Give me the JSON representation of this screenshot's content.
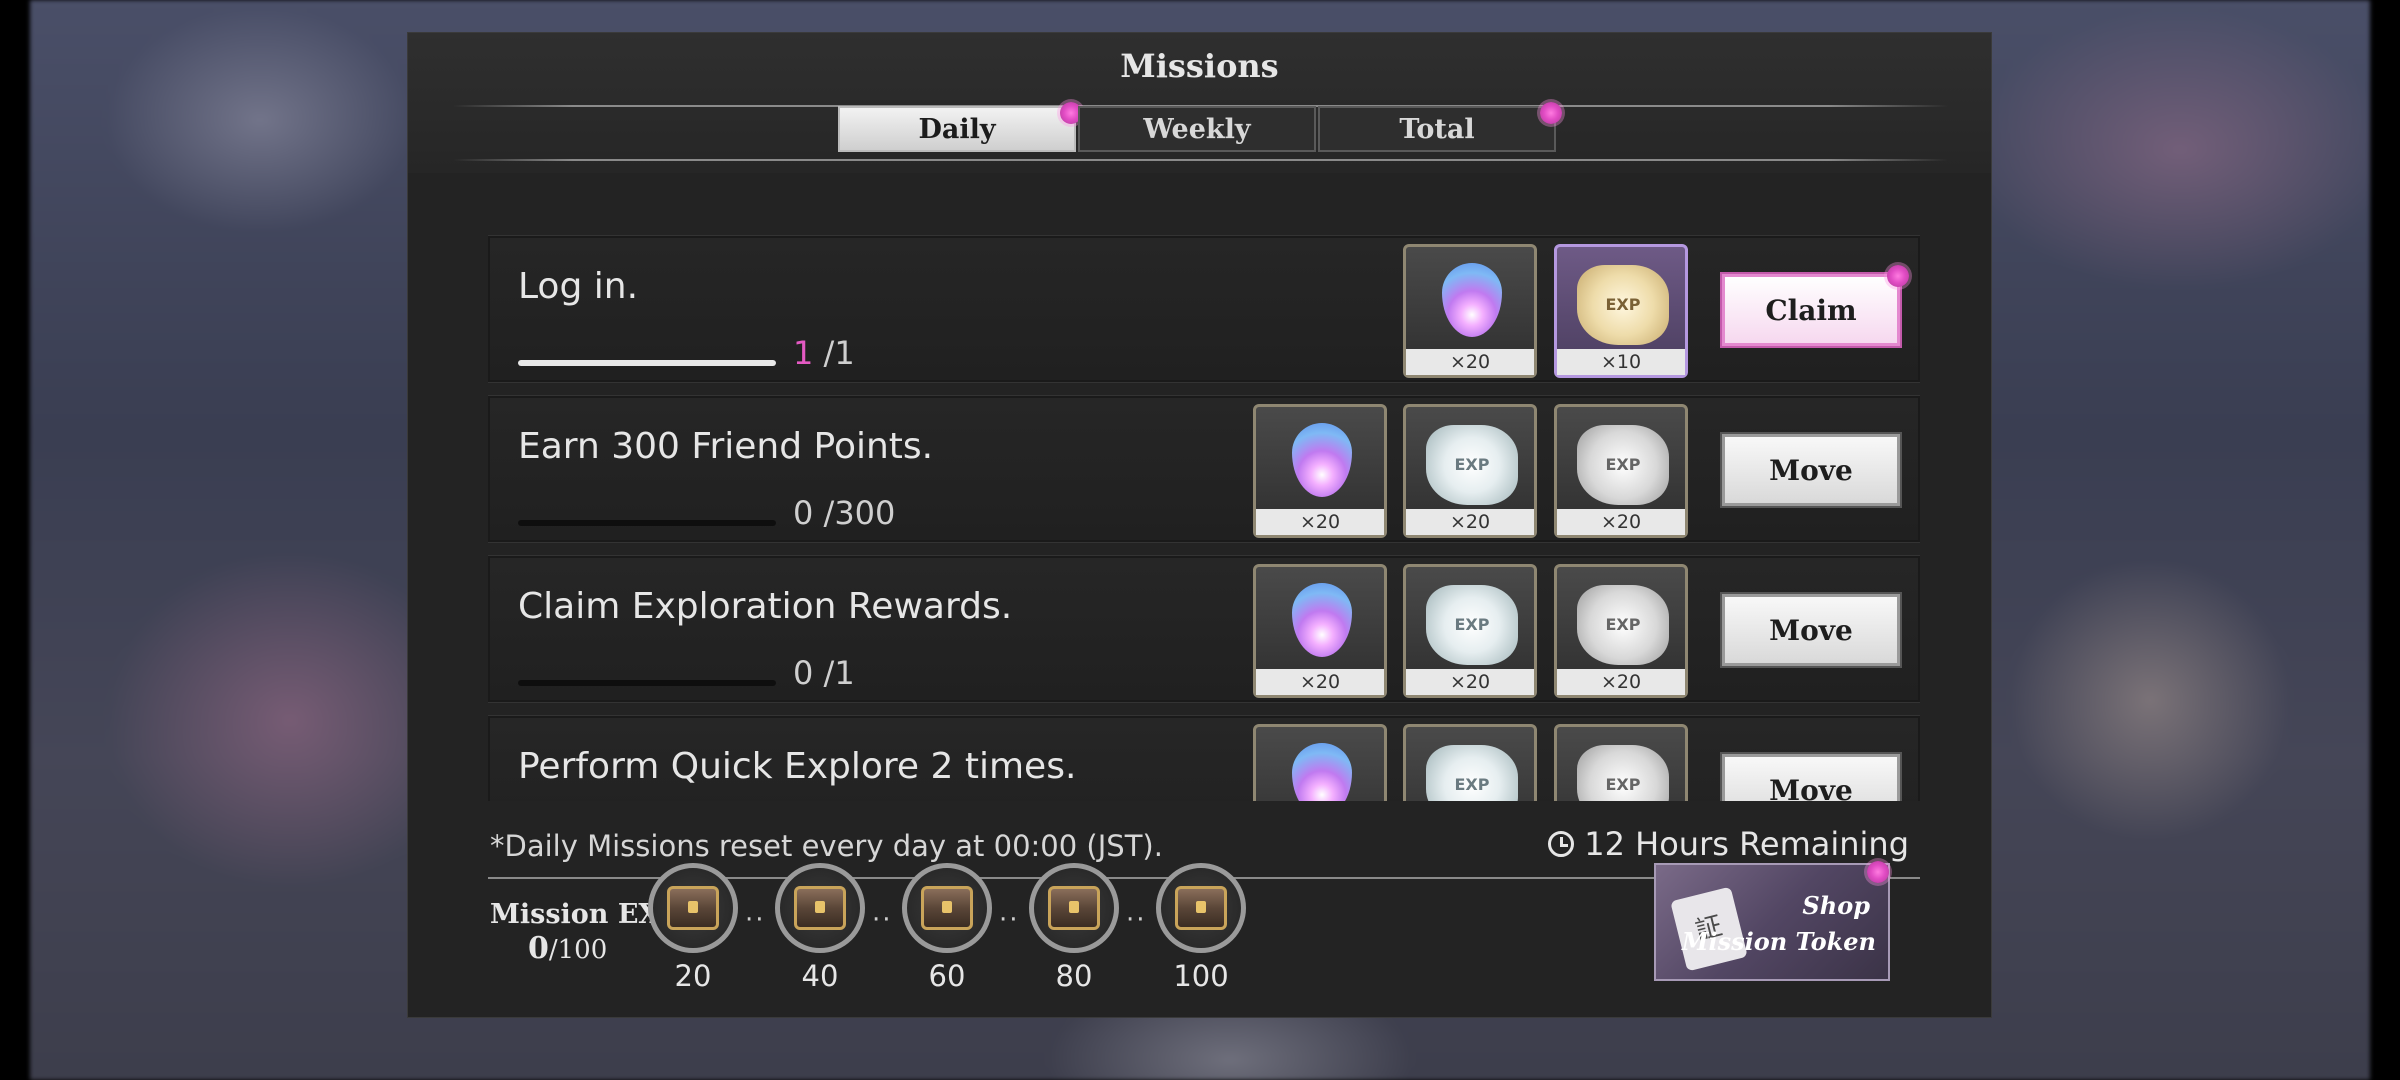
{
  "window": {
    "title": "Missions"
  },
  "tabs": [
    {
      "label": "Daily",
      "active": true,
      "notification": true
    },
    {
      "label": "Weekly",
      "active": false,
      "notification": false
    },
    {
      "label": "Total",
      "active": false,
      "notification": true
    }
  ],
  "missions": [
    {
      "title": "Log in.",
      "progress_current": "1",
      "progress_total": "/1",
      "progress_fraction": 1.0,
      "completed": true,
      "rewards": [
        {
          "icon": "spirit-orb-icon",
          "qty": "×20"
        },
        {
          "icon": "gold-exp-scroll-icon",
          "qty": "×10"
        }
      ],
      "action": "Claim",
      "action_notification": true
    },
    {
      "title": "Earn 300 Friend Points.",
      "progress_current": "0",
      "progress_total": "/300",
      "progress_fraction": 0.0,
      "completed": false,
      "rewards": [
        {
          "icon": "spirit-orb-icon",
          "qty": "×20"
        },
        {
          "icon": "silver-exp-scroll-icon",
          "qty": "×20"
        },
        {
          "icon": "grey-exp-scroll-icon",
          "qty": "×20"
        }
      ],
      "action": "Move"
    },
    {
      "title": "Claim Exploration Rewards.",
      "progress_current": "0",
      "progress_total": "/1",
      "progress_fraction": 0.0,
      "completed": false,
      "rewards": [
        {
          "icon": "spirit-orb-icon",
          "qty": "×20"
        },
        {
          "icon": "silver-exp-scroll-icon",
          "qty": "×20"
        },
        {
          "icon": "grey-exp-scroll-icon",
          "qty": "×20"
        }
      ],
      "action": "Move"
    },
    {
      "title": "Perform Quick Explore 2 times.",
      "rewards": [
        {
          "icon": "spirit-orb-icon"
        },
        {
          "icon": "silver-exp-scroll-icon"
        },
        {
          "icon": "grey-exp-scroll-icon"
        }
      ],
      "action": "Move"
    }
  ],
  "reward_icon_text": {
    "exp": "EXP"
  },
  "footer": {
    "note": "*Daily Missions reset every day at 00:00 (JST).",
    "remaining": "12 Hours Remaining"
  },
  "mission_exp": {
    "label": "Mission EXP",
    "current": "0",
    "max": "/100",
    "milestones": [
      "20",
      "40",
      "60",
      "80",
      "100"
    ]
  },
  "shop": {
    "line1": "Shop",
    "line2": "Mission Token",
    "tag_glyph": "証",
    "notification": true
  },
  "close_glyph": "✕",
  "colors": {
    "accent_pink": "#e45ac3",
    "panel_bg": "#232323"
  }
}
